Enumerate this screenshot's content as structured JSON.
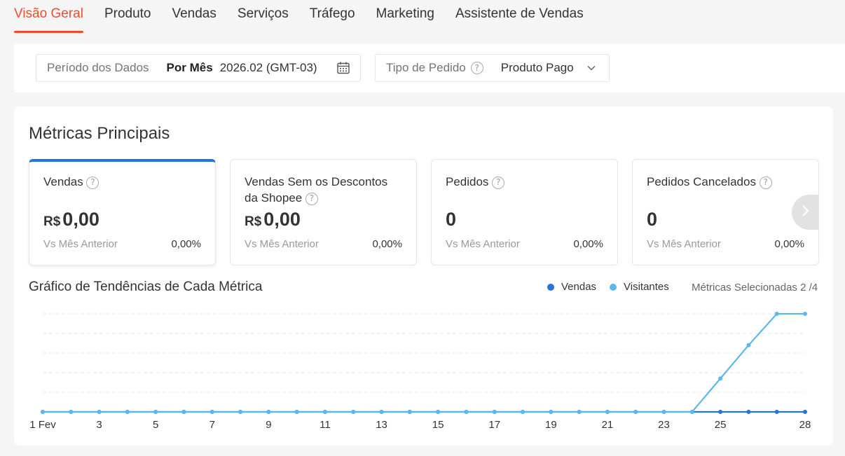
{
  "tabs": [
    {
      "label": "Visão Geral",
      "active": true
    },
    {
      "label": "Produto"
    },
    {
      "label": "Vendas"
    },
    {
      "label": "Serviços"
    },
    {
      "label": "Tráfego"
    },
    {
      "label": "Marketing"
    },
    {
      "label": "Assistente de Vendas"
    }
  ],
  "filters": {
    "period_label": "Período dos Dados",
    "period_mode": "Por Mês",
    "period_value": "2026.02 (GMT-03)",
    "order_type_label": "Tipo de Pedido",
    "order_type_value": "Produto Pago"
  },
  "main": {
    "title": "Métricas Principais",
    "metrics": [
      {
        "label": "Vendas",
        "currency": "R$",
        "value": "0,00",
        "compare_label": "Vs Mês Anterior",
        "change": "0,00%"
      },
      {
        "label": "Vendas Sem os Descontos da Shopee",
        "currency": "R$",
        "value": "0,00",
        "compare_label": "Vs Mês Anterior",
        "change": "0,00%"
      },
      {
        "label": "Pedidos",
        "currency": "",
        "value": "0",
        "compare_label": "Vs Mês Anterior",
        "change": "0,00%"
      },
      {
        "label": "Pedidos Cancelados",
        "currency": "",
        "value": "0",
        "compare_label": "Vs Mês Anterior",
        "change": "0,00%"
      }
    ],
    "chart_title": "Gráfico de Tendências de Cada Métrica",
    "selected_metrics": "Métricas Selecionadas 2 /4"
  },
  "colors": {
    "accent": "#ee4d2d",
    "selected_border": "#2673dd",
    "vendas": "#2673dd",
    "visitantes": "#5bb8ea"
  },
  "icons": {
    "period": "calendar-icon",
    "order_type": "chevron-down-icon",
    "help": "question-circle-icon",
    "next": "chevron-right-icon"
  },
  "chart_data": {
    "type": "line",
    "x": [
      1,
      2,
      3,
      4,
      5,
      6,
      7,
      8,
      9,
      10,
      11,
      12,
      13,
      14,
      15,
      16,
      17,
      18,
      19,
      20,
      21,
      22,
      23,
      24,
      25,
      26,
      27,
      28
    ],
    "tick_labels": [
      "1 Fev",
      "3",
      "5",
      "7",
      "9",
      "11",
      "13",
      "15",
      "17",
      "19",
      "21",
      "23",
      "25",
      "28"
    ],
    "tick_positions": [
      1,
      3,
      5,
      7,
      9,
      11,
      13,
      15,
      17,
      19,
      21,
      23,
      25,
      28
    ],
    "ylim": [
      0,
      5
    ],
    "grid": true,
    "legend_position": "top-right",
    "series": [
      {
        "name": "Vendas",
        "color": "#2673dd",
        "values": [
          0,
          0,
          0,
          0,
          0,
          0,
          0,
          0,
          0,
          0,
          0,
          0,
          0,
          0,
          0,
          0,
          0,
          0,
          0,
          0,
          0,
          0,
          0,
          0,
          0,
          0,
          0,
          0
        ]
      },
      {
        "name": "Visitantes",
        "color": "#5bb8ea",
        "values": [
          0,
          0,
          0,
          0,
          0,
          0,
          0,
          0,
          0,
          0,
          0,
          0,
          0,
          0,
          0,
          0,
          0,
          0,
          0,
          0,
          0,
          0,
          0,
          0,
          1.7,
          3.4,
          5,
          5
        ]
      }
    ]
  }
}
